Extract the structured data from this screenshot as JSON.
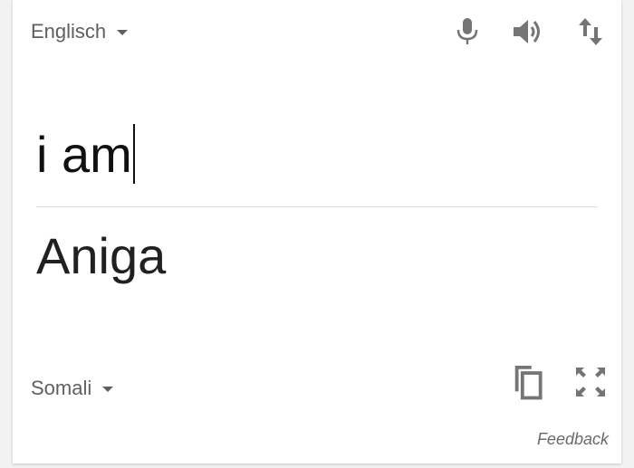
{
  "source": {
    "language": "Englisch",
    "text": "i am"
  },
  "target": {
    "language": "Somali",
    "text": "Aniga"
  },
  "toolbar": {
    "icons": [
      "microphone-icon",
      "speaker-icon",
      "swap-languages-icon"
    ]
  },
  "result_actions": {
    "icons": [
      "copy-icon",
      "fullscreen-icon"
    ]
  },
  "footer": {
    "feedback_label": "Feedback"
  },
  "colors": {
    "icon": "#757575",
    "text": "#212121",
    "label": "#5f5f5f",
    "divider": "#dcdcdc"
  }
}
